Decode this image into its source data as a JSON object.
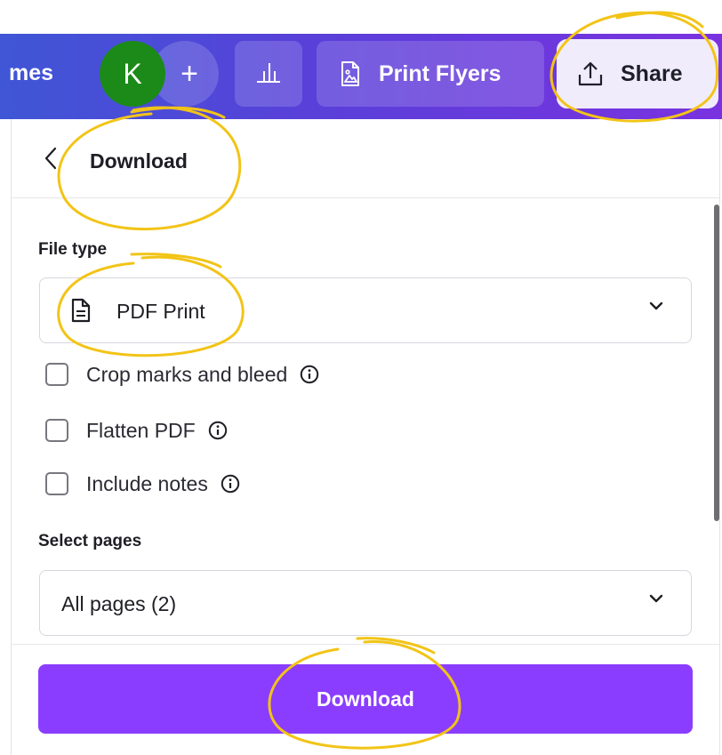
{
  "topbar": {
    "templates_fragment": "mes",
    "avatar_initial": "K",
    "add_symbol": "+",
    "print_flyers_label": "Print Flyers",
    "share_label": "Share",
    "icons": {
      "chart": "bar-chart-icon",
      "print": "image-file-icon",
      "share": "upload-share-icon"
    }
  },
  "panel": {
    "title": "Download",
    "file_type": {
      "label": "File type",
      "selected": "PDF Print",
      "icon": "document-icon"
    },
    "options": [
      {
        "label": "Crop marks and bleed",
        "checked": false
      },
      {
        "label": "Flatten PDF",
        "checked": false
      },
      {
        "label": "Include notes",
        "checked": false
      }
    ],
    "select_pages": {
      "label": "Select pages",
      "selected": "All pages (2)"
    },
    "download_button_label": "Download"
  },
  "colors": {
    "topbar_gradient_start": "#3f56d6",
    "topbar_gradient_end": "#7a32e0",
    "avatar": "#1b8a18",
    "share_button_bg": "#f1ecfb",
    "download_button": "#8b3dff",
    "annotation_marker": "#f2c417"
  }
}
